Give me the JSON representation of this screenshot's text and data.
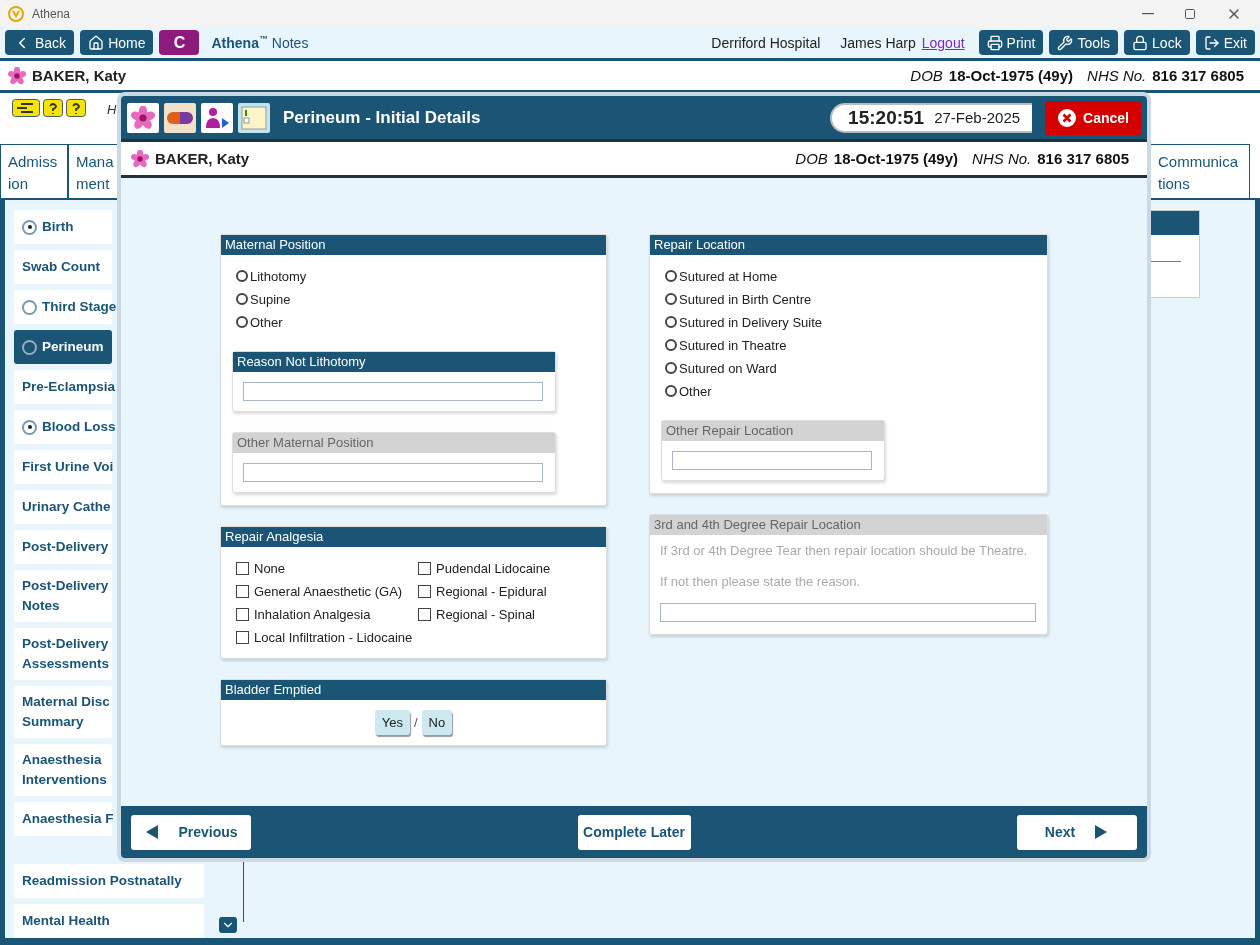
{
  "app_title": "Athena",
  "toolbar": {
    "left_buttons": [
      {
        "label": "Back",
        "kind": "back"
      },
      {
        "label": "Home",
        "kind": "home"
      },
      {
        "label": "C",
        "kind": "module"
      }
    ],
    "brand": "Athena",
    "brand_mark": "™",
    "module": "Notes",
    "hospital": "Derriford Hospital",
    "user": "James Harp",
    "logout": "Logout",
    "right_buttons": [
      {
        "label": "Print",
        "kind": "print"
      },
      {
        "label": "Tools",
        "kind": "tools"
      },
      {
        "label": "Lock",
        "kind": "lock"
      },
      {
        "label": "Exit",
        "kind": "exit"
      }
    ]
  },
  "patient": {
    "name": "BAKER, Katy",
    "dob_label": "DOB",
    "dob": "18-Oct-1975 (49y)",
    "nhs_label": "NHS No.",
    "nhs": "816 317 6805"
  },
  "banner_text": "H",
  "tabs": [
    {
      "lines": [
        "Admiss",
        "ion"
      ]
    },
    {
      "lines": [
        "Mana",
        "ment"
      ]
    },
    {
      "lines": [
        "Communica",
        "tions"
      ]
    }
  ],
  "sidebar": [
    {
      "lines": [
        "Birth"
      ],
      "kind": "radio",
      "checked": true,
      "selected": false
    },
    {
      "lines": [
        "Swab Count"
      ],
      "kind": "plain",
      "selected": false
    },
    {
      "lines": [
        "Third Stage"
      ],
      "kind": "radio",
      "checked": false,
      "selected": false
    },
    {
      "lines": [
        "Perineum"
      ],
      "kind": "radio",
      "checked": false,
      "selected": true
    },
    {
      "lines": [
        "Pre-Eclampsia"
      ],
      "kind": "plain",
      "selected": false
    },
    {
      "lines": [
        "Blood Loss"
      ],
      "kind": "radio",
      "checked": true,
      "selected": false
    },
    {
      "lines": [
        "First Urine Voi"
      ],
      "kind": "plain",
      "selected": false
    },
    {
      "lines": [
        "Urinary Cathe"
      ],
      "kind": "plain",
      "selected": false
    },
    {
      "lines": [
        "Post-Delivery"
      ],
      "kind": "plain",
      "selected": false
    },
    {
      "lines": [
        "Post-Delivery",
        "Notes"
      ],
      "kind": "plain",
      "selected": false
    },
    {
      "lines": [
        "Post-Delivery",
        "Assessments"
      ],
      "kind": "plain",
      "selected": false
    },
    {
      "lines": [
        "Maternal Disc",
        "Summary"
      ],
      "kind": "plain",
      "selected": false
    },
    {
      "lines": [
        "Anaesthesia",
        "Interventions"
      ],
      "kind": "plain",
      "selected": false
    },
    {
      "lines": [
        "Anaesthesia F"
      ],
      "kind": "plain",
      "selected": false
    }
  ],
  "sidebar_lower": [
    {
      "lines": [
        "Readmission Postnatally"
      ],
      "selected": false
    },
    {
      "lines": [
        "Mental Health"
      ],
      "selected": false
    }
  ],
  "modal": {
    "title": "Perineum - Initial Details",
    "time": "15:20:51",
    "date": "27-Feb-2025",
    "cancel": "Cancel",
    "patient": {
      "name": "BAKER, Katy",
      "dob_label": "DOB",
      "dob": "18-Oct-1975 (49y)",
      "nhs_label": "NHS No.",
      "nhs": "816 317 6805"
    },
    "maternal_position": {
      "title": "Maternal Position",
      "options": [
        {
          "label": "Lithotomy",
          "selected": false
        },
        {
          "label": "Supine",
          "selected": false
        },
        {
          "label": "Other",
          "selected": false
        }
      ],
      "subpanels": [
        {
          "title": "Reason Not Lithotomy",
          "disabled": false
        },
        {
          "title": "Other Maternal Position",
          "disabled": true
        }
      ]
    },
    "repair_analgesia": {
      "title": "Repair Analgesia",
      "options": [
        {
          "label": "None",
          "checked": false
        },
        {
          "label": "General Anaesthetic (GA)",
          "checked": false
        },
        {
          "label": "Inhalation Analgesia",
          "checked": false
        },
        {
          "label": "Local Infiltration - Lidocaine",
          "checked": false
        },
        {
          "label": "Pudendal Lidocaine",
          "checked": false
        },
        {
          "label": "Regional - Epidural",
          "checked": false
        },
        {
          "label": "Regional - Spinal",
          "checked": false
        }
      ]
    },
    "bladder_emptied": {
      "title": "Bladder Emptied",
      "separator": "/",
      "options": [
        {
          "label": "Yes",
          "selected": false
        },
        {
          "label": "No",
          "selected": false
        }
      ]
    },
    "repair_location": {
      "title": "Repair Location",
      "options": [
        {
          "label": "Sutured at Home",
          "selected": false
        },
        {
          "label": "Sutured in Birth Centre",
          "selected": false
        },
        {
          "label": "Sutured in Delivery Suite",
          "selected": false
        },
        {
          "label": "Sutured in Theatre",
          "selected": false
        },
        {
          "label": "Sutured on Ward",
          "selected": false
        },
        {
          "label": "Other",
          "selected": false
        }
      ],
      "subpanel": {
        "title": "Other Repair Location",
        "disabled": true
      }
    },
    "degree_repair": {
      "title": "3rd and 4th Degree Repair Location",
      "disabled": true,
      "notes": [
        "If 3rd or 4th Degree Tear then repair location should be Theatre.",
        "If not then please state the reason."
      ]
    },
    "footer": {
      "previous": "Previous",
      "complete_later": "Complete Later",
      "next": "Next"
    }
  }
}
